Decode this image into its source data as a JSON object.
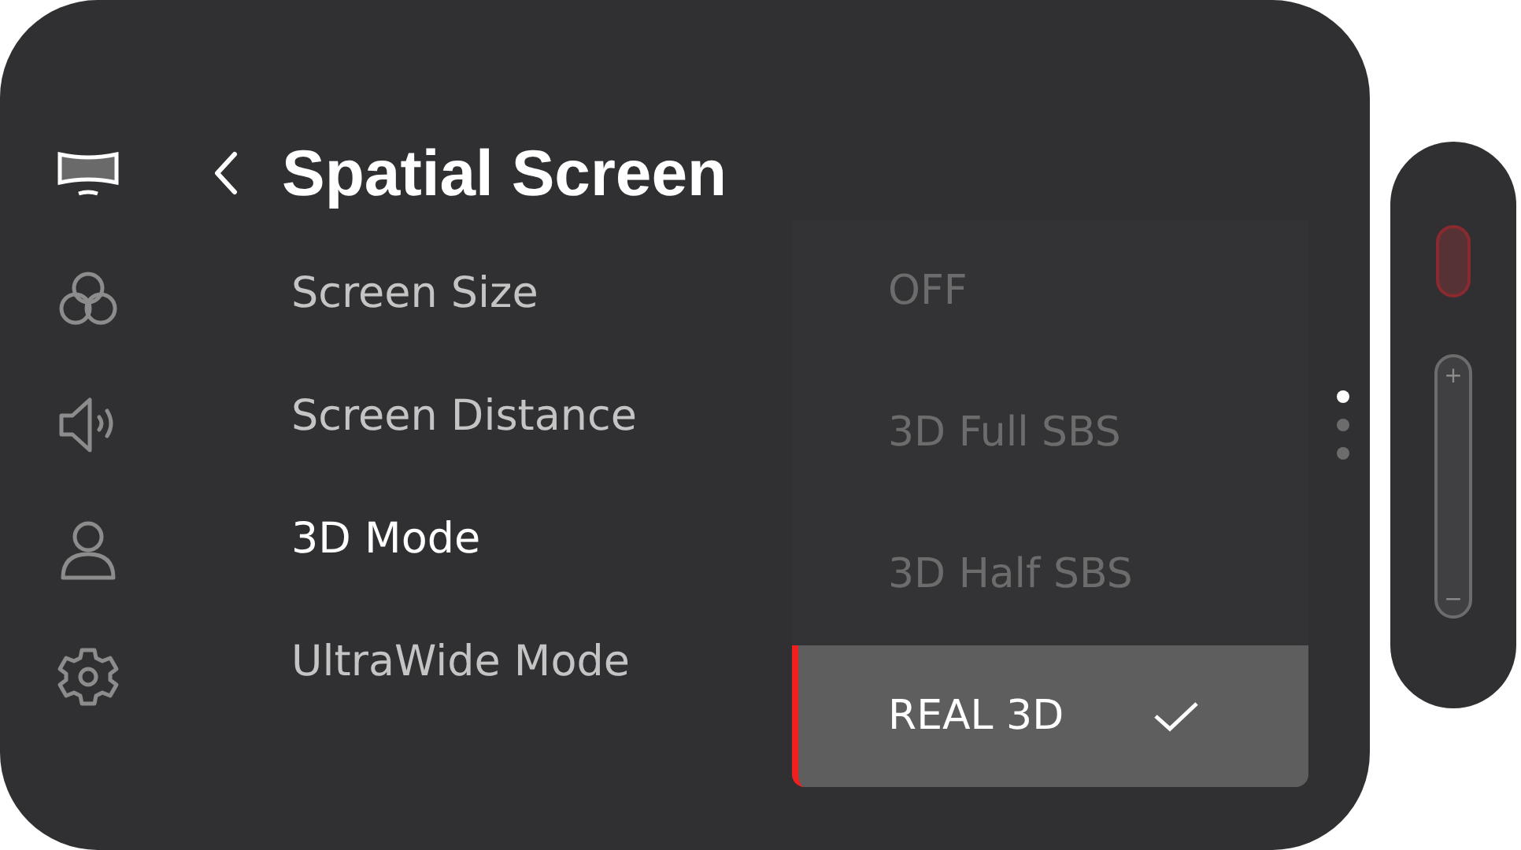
{
  "sidebar": {
    "items": [
      {
        "kind": "screen",
        "selected": true
      },
      {
        "kind": "color",
        "selected": false
      },
      {
        "kind": "sound",
        "selected": false
      },
      {
        "kind": "user",
        "selected": false
      },
      {
        "kind": "settings",
        "selected": false
      }
    ]
  },
  "title": "Spatial Screen",
  "menu": [
    {
      "label": "Screen Size",
      "selected": false
    },
    {
      "label": "Screen Distance",
      "selected": false
    },
    {
      "label": "3D Mode",
      "selected": true
    },
    {
      "label": "UltraWide Mode",
      "selected": false
    }
  ],
  "dropdown": {
    "options": [
      {
        "label": "OFF",
        "selected": false
      },
      {
        "label": "3D Full SBS",
        "selected": false
      },
      {
        "label": "3D Half SBS",
        "selected": false
      },
      {
        "label": "REAL 3D",
        "selected": true
      }
    ]
  },
  "pager": [
    {
      "selected": true
    },
    {
      "selected": false
    },
    {
      "selected": false
    }
  ],
  "side_panel": {
    "volume": {
      "plus": "+",
      "minus": "−"
    }
  }
}
